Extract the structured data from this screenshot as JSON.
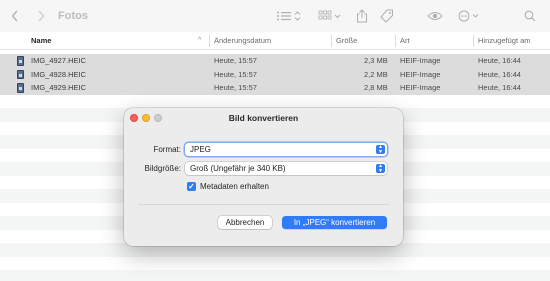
{
  "window": {
    "title": "Fotos"
  },
  "toolbar": {
    "back_icon": "chevron-left-icon",
    "forward_icon": "chevron-right-icon",
    "view_list_icon": "list-view-icon",
    "group_icon": "grid-group-icon",
    "share_icon": "share-icon",
    "tag_icon": "tag-icon",
    "quicklook_icon": "eye-icon",
    "more_icon": "ellipsis-circle-icon",
    "search_icon": "search-icon"
  },
  "columns": {
    "name": "Name",
    "modified": "Änderungsdatum",
    "size": "Größe",
    "kind": "Art",
    "added": "Hinzugefügt am"
  },
  "files": [
    {
      "name": "IMG_4927.HEIC",
      "modified": "Heute, 15:57",
      "size": "2,3 MB",
      "kind": "HEIF-Image",
      "added": "Heute, 16:44"
    },
    {
      "name": "IMG_4928.HEIC",
      "modified": "Heute, 15:57",
      "size": "2,2 MB",
      "kind": "HEIF-Image",
      "added": "Heute, 16:44"
    },
    {
      "name": "IMG_4929.HEIC",
      "modified": "Heute, 15:57",
      "size": "2,8 MB",
      "kind": "HEIF-Image",
      "added": "Heute, 16:44"
    }
  ],
  "dialog": {
    "title": "Bild konvertieren",
    "format_label": "Format:",
    "format_value": "JPEG",
    "size_label": "Bildgröße:",
    "size_value": "Groß (Ungefähr je 340 KB)",
    "metadata_label": "Metadaten erhalten",
    "metadata_checked": true,
    "cancel_label": "Abbrechen",
    "convert_label": "In „JPEG“ konvertieren"
  },
  "colors": {
    "accent": "#2f7cf6",
    "selection": "#dcdcdc",
    "close": "#ff5f57",
    "minimize": "#febc2e"
  }
}
